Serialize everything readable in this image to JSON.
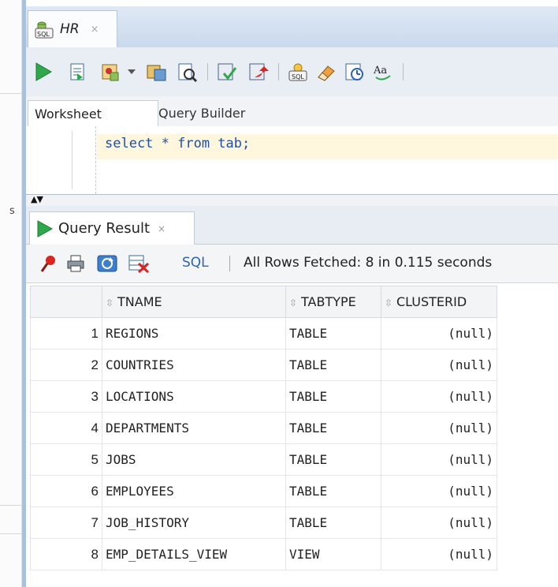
{
  "window": {
    "tab_title": "HR",
    "tab_close": "×"
  },
  "toolbar": {
    "icons": [
      "run-statement-icon",
      "run-script-icon",
      "autotrace-icon",
      "dropdown-arrow-icon",
      "explain-plan-icon",
      "sql-tuning-icon",
      "commit-icon",
      "rollback-icon",
      "unshared-sql-icon",
      "clear-icon",
      "sql-history-icon",
      "format-case-icon"
    ]
  },
  "worksheet": {
    "tabs": [
      "Worksheet",
      "Query Builder"
    ],
    "sql_text": "select * from tab;"
  },
  "result": {
    "tab_label": "Query Result",
    "tab_close": "×",
    "sql_label": "SQL",
    "status": "All Rows Fetched: 8 in 0.115 seconds",
    "columns": [
      "TNAME",
      "TABTYPE",
      "CLUSTERID"
    ],
    "rows": [
      {
        "num": "1",
        "tname": "REGIONS",
        "tabtype": "TABLE",
        "clusterid": "(null)"
      },
      {
        "num": "2",
        "tname": "COUNTRIES",
        "tabtype": "TABLE",
        "clusterid": "(null)"
      },
      {
        "num": "3",
        "tname": "LOCATIONS",
        "tabtype": "TABLE",
        "clusterid": "(null)"
      },
      {
        "num": "4",
        "tname": "DEPARTMENTS",
        "tabtype": "TABLE",
        "clusterid": "(null)"
      },
      {
        "num": "5",
        "tname": "JOBS",
        "tabtype": "TABLE",
        "clusterid": "(null)"
      },
      {
        "num": "6",
        "tname": "EMPLOYEES",
        "tabtype": "TABLE",
        "clusterid": "(null)"
      },
      {
        "num": "7",
        "tname": "JOB_HISTORY",
        "tabtype": "TABLE",
        "clusterid": "(null)"
      },
      {
        "num": "8",
        "tname": "EMP_DETAILS_VIEW",
        "tabtype": "VIEW",
        "clusterid": "(null)"
      }
    ]
  },
  "side": {
    "mark": "s"
  },
  "colors": {
    "accent_blue": "#2a62b8",
    "run_green": "#2ea84a",
    "editor_highlight": "#fff7dd"
  }
}
